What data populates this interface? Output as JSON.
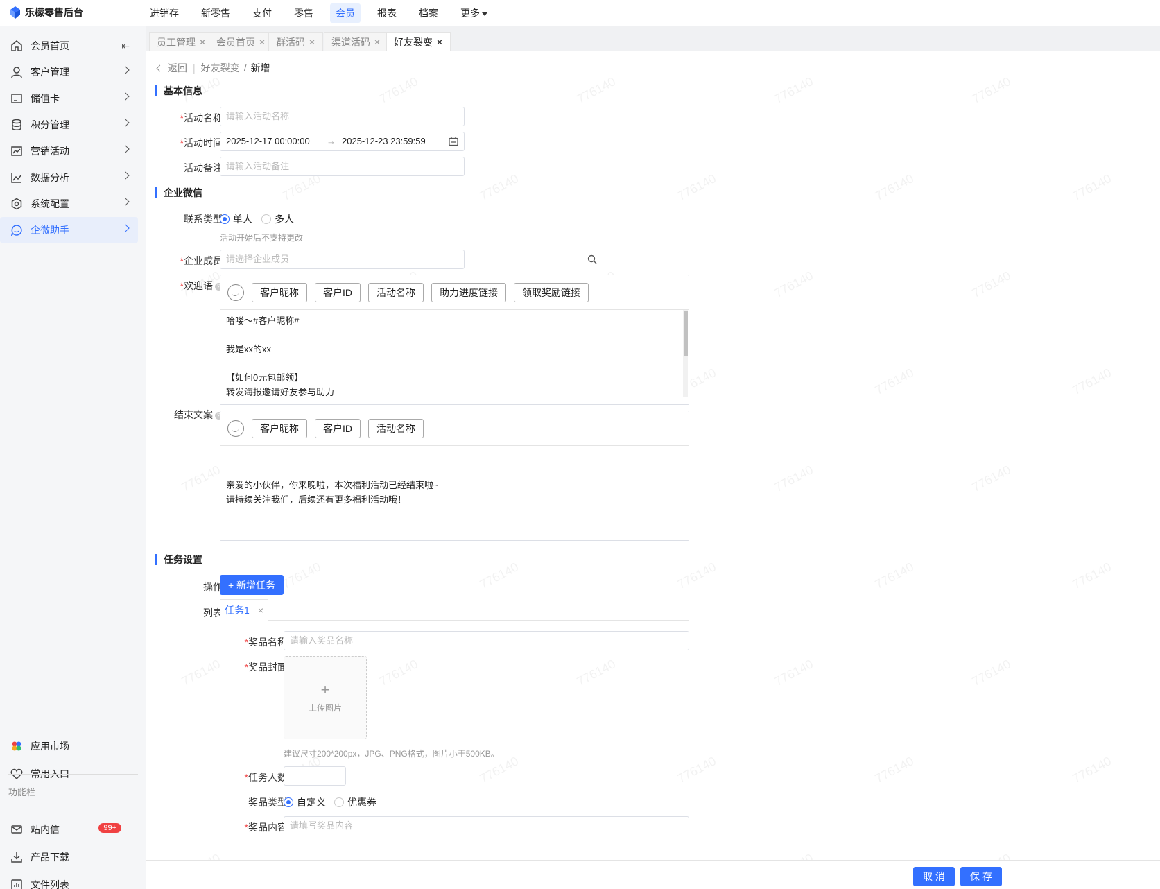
{
  "app": {
    "title": "乐檬零售后台"
  },
  "topnav": {
    "items": [
      {
        "label": "进销存"
      },
      {
        "label": "新零售"
      },
      {
        "label": "支付"
      },
      {
        "label": "零售"
      },
      {
        "label": "会员",
        "active": true
      },
      {
        "label": "报表"
      },
      {
        "label": "档案"
      },
      {
        "label": "更多"
      }
    ]
  },
  "sidebar": {
    "items": [
      {
        "label": "会员首页",
        "icon": "home-icon"
      },
      {
        "label": "客户管理",
        "icon": "user-icon"
      },
      {
        "label": "储值卡",
        "icon": "card-icon"
      },
      {
        "label": "积分管理",
        "icon": "database-icon"
      },
      {
        "label": "营销活动",
        "icon": "chart-card-icon"
      },
      {
        "label": "数据分析",
        "icon": "line-chart-icon"
      },
      {
        "label": "系统配置",
        "icon": "settings-icon"
      },
      {
        "label": "企微助手",
        "icon": "chat-icon",
        "active": true
      }
    ],
    "bottom": [
      {
        "label": "应用市场",
        "icon": "app-market-icon"
      },
      {
        "label": "常用入口",
        "icon": "heart-icon"
      }
    ],
    "section_label": "功能栏",
    "tools": [
      {
        "label": "站内信",
        "icon": "mail-icon",
        "badge": "99+"
      },
      {
        "label": "产品下载",
        "icon": "download-icon"
      },
      {
        "label": "文件列表",
        "icon": "file-list-icon"
      }
    ]
  },
  "tabs": [
    {
      "label": "员工管理"
    },
    {
      "label": "会员首页"
    },
    {
      "label": "群活码"
    },
    {
      "label": "渠道活码"
    },
    {
      "label": "好友裂变",
      "active": true
    }
  ],
  "breadcrumb": {
    "back": "返回",
    "parent": "好友裂变",
    "sep": "/",
    "current": "新增"
  },
  "basic": {
    "title": "基本信息",
    "name_label": "活动名称",
    "name_placeholder": "请输入活动名称",
    "time_label": "活动时间",
    "time_start": "2025-12-17 00:00:00",
    "time_arrow": "→",
    "time_end": "2025-12-23 23:59:59",
    "remark_label": "活动备注",
    "remark_placeholder": "请输入活动备注"
  },
  "wecom": {
    "title": "企业微信",
    "contact_label": "联系类型",
    "contact_options": [
      "单人",
      "多人"
    ],
    "contact_selected": "单人",
    "contact_hint": "活动开始后不支持更改",
    "member_label": "企业成员",
    "member_placeholder": "请选择企业成员",
    "welcome_label": "欢迎语",
    "welcome_tools": [
      "客户昵称",
      "客户ID",
      "活动名称",
      "助力进度链接",
      "领取奖励链接"
    ],
    "welcome_text": "哈喽～#客户昵称#\n\n我是xx的xx\n\n【如何0元包邮领】\n转发海报邀请好友参与助力",
    "end_label": "结束文案",
    "end_tools": [
      "客户昵称",
      "客户ID",
      "活动名称"
    ],
    "end_text": "\n\n亲爱的小伙伴，你来晚啦，本次福利活动已经结束啦~\n请持续关注我们，后续还有更多福利活动哦！"
  },
  "task": {
    "title": "任务设置",
    "op_label": "操作",
    "add_button": "+ 新增任务",
    "list_label": "列表",
    "task_tab": "任务1",
    "task_tab_close": "×",
    "prize_name_label": "奖品名称",
    "prize_name_placeholder": "请输入奖品名称",
    "prize_cover_label": "奖品封面",
    "upload_plus": "+",
    "upload_label": "上传图片",
    "upload_hint": "建议尺寸200*200px，JPG、PNG格式，图片小于500KB。",
    "count_label": "任务人数",
    "count_value": "",
    "prize_type_label": "奖品类型",
    "prize_type_options": [
      "自定义",
      "优惠券"
    ],
    "prize_type_selected": "自定义",
    "prize_content_label": "奖品内容",
    "prize_content_placeholder": "请填写奖品内容"
  },
  "footer": {
    "cancel": "取 消",
    "save": "保 存"
  },
  "watermark": "776140",
  "colors": {
    "accent": "#3370ff",
    "required": "#f04142",
    "badge": "#f04142"
  }
}
